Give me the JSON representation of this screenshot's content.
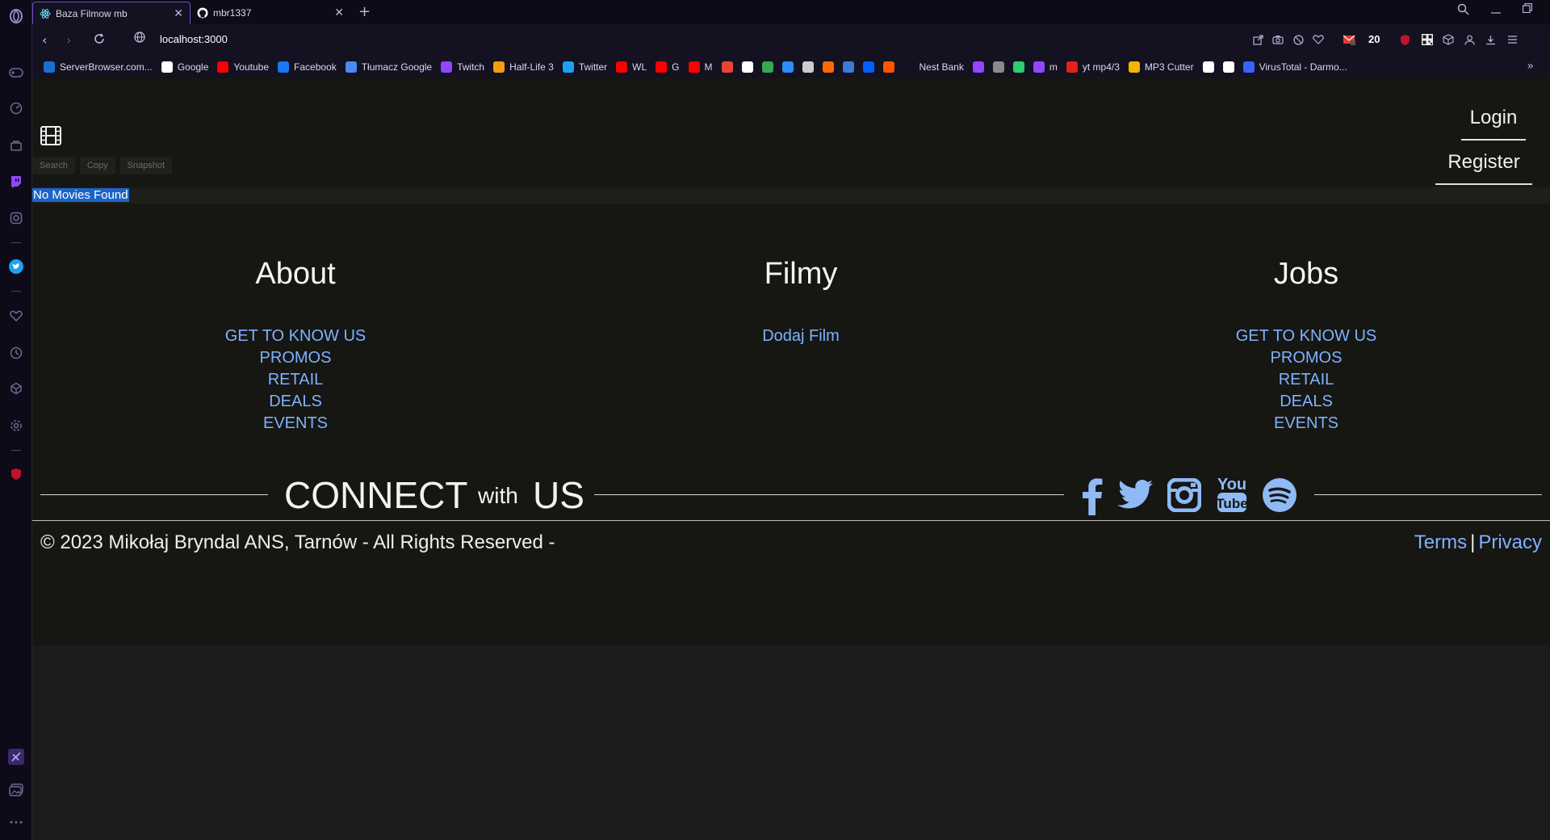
{
  "browser": {
    "tabs": [
      {
        "title": "Baza Filmow mb",
        "active": true
      },
      {
        "title": "mbr1337",
        "active": false
      }
    ],
    "url": "localhost:3000",
    "badge_count": "20",
    "bookmarks": [
      {
        "label": "ServerBrowser.com...",
        "color": "#1a6fd4"
      },
      {
        "label": "Google",
        "color": "#ffffff"
      },
      {
        "label": "Youtube",
        "color": "#ff0000"
      },
      {
        "label": "Facebook",
        "color": "#1877f2"
      },
      {
        "label": "Tłumacz Google",
        "color": "#4a8af4"
      },
      {
        "label": "Twitch",
        "color": "#9146ff"
      },
      {
        "label": "Half-Life 3",
        "color": "#f39c12"
      },
      {
        "label": "Twitter",
        "color": "#1da1f2"
      },
      {
        "label": "WL",
        "color": "#ff0000"
      },
      {
        "label": "G",
        "color": "#ff0000"
      },
      {
        "label": "M",
        "color": "#ff0000"
      },
      {
        "label": "",
        "color": "#ea4335"
      },
      {
        "label": "",
        "color": "#ffffff"
      },
      {
        "label": "",
        "color": "#34a853"
      },
      {
        "label": "",
        "color": "#2d8cff"
      },
      {
        "label": "",
        "color": "#cccccc"
      },
      {
        "label": "",
        "color": "#ff6a00"
      },
      {
        "label": "",
        "color": "#3b7bd8"
      },
      {
        "label": "",
        "color": "#0061ff"
      },
      {
        "label": "",
        "color": "#ff5500"
      },
      {
        "label": "Nest Bank",
        "color": "#141120"
      },
      {
        "label": "",
        "color": "#9146ff"
      },
      {
        "label": "",
        "color": "#8a8a8a"
      },
      {
        "label": "",
        "color": "#2ecc71"
      },
      {
        "label": "m",
        "color": "#9146ff"
      },
      {
        "label": "yt mp4/3",
        "color": "#e62117"
      },
      {
        "label": "MP3 Cutter",
        "color": "#f5b400"
      },
      {
        "label": "",
        "color": "#ffffff"
      },
      {
        "label": "",
        "color": "#ffffff"
      },
      {
        "label": "VirusTotal - Darmo...",
        "color": "#3b61ff"
      }
    ]
  },
  "header": {
    "tool_buttons": [
      "Search",
      "Copy",
      "Snapshot"
    ],
    "login": "Login",
    "register": "Register"
  },
  "status_text": "No Movies Found",
  "footer": {
    "columns": [
      {
        "title": "About",
        "links": [
          "GET TO KNOW US",
          "PROMOS",
          "RETAIL",
          "DEALS",
          "EVENTS"
        ]
      },
      {
        "title": "Filmy",
        "links": [
          "Dodaj Film"
        ]
      },
      {
        "title": "Jobs",
        "links": [
          "GET TO KNOW US",
          "PROMOS",
          "RETAIL",
          "DEALS",
          "EVENTS"
        ]
      }
    ],
    "connect": {
      "word1": "CONNECT",
      "word2": "with",
      "word3": "US"
    },
    "social_icons": [
      "facebook-icon",
      "twitter-icon",
      "instagram-icon",
      "youtube-icon",
      "spotify-icon"
    ],
    "copyright": "© 2023 Mikołaj Bryndal ANS, Tarnów - All Rights Reserved -",
    "terms": "Terms",
    "separator": "|",
    "privacy": "Privacy"
  },
  "colors": {
    "accent_link": "#7fb2ff",
    "selection": "#1c64c8",
    "tab_border": "#6e4cc7"
  }
}
